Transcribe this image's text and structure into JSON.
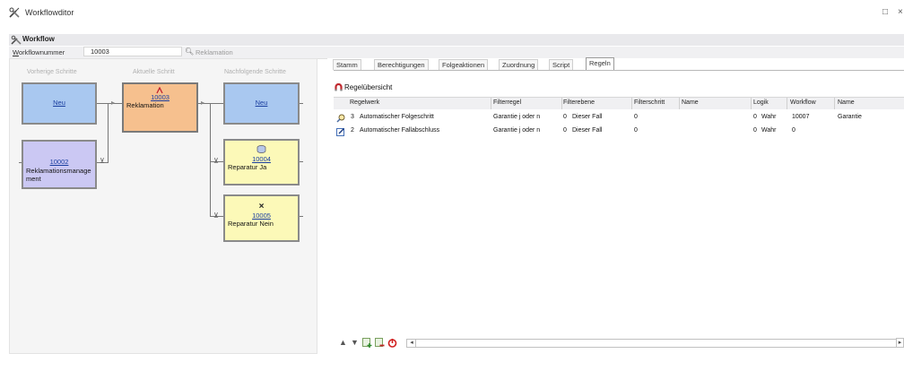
{
  "window": {
    "title": "Workflowditor",
    "maximize_glyph": "□",
    "close_glyph": "×",
    "icon": "tools-icon"
  },
  "workflow_section": {
    "label": "Workflow",
    "icon": "tools-icon"
  },
  "number_row": {
    "label_prefix": "W",
    "label_rest": "orkflownummer",
    "value": "10003",
    "search_icon": "search-icon",
    "name": "Reklamation"
  },
  "columns": {
    "previous": "Vorherige Schritte",
    "current": "Aktuelle Schritt",
    "next": "Nachfolgende Schritte"
  },
  "nodes": {
    "prev_new": {
      "link": "Neu"
    },
    "prev_10002": {
      "link": "10002",
      "name": "Reklamationsmanage ment"
    },
    "current": {
      "link": "10003",
      "name": "Reklamation"
    },
    "next_new": {
      "link": "Neu"
    },
    "next_10004": {
      "link": "10004",
      "name": "Reparatur Ja"
    },
    "next_10005": {
      "link": "10005",
      "name": "Reparatur Nein",
      "mark": "×"
    }
  },
  "tabs": [
    {
      "label": "Stamm",
      "active": false
    },
    {
      "label": "Berechtigungen",
      "active": false
    },
    {
      "label": "Folgeaktionen",
      "active": false
    },
    {
      "label": "Zuordnung",
      "active": false
    },
    {
      "label": "Script",
      "active": false
    },
    {
      "label": "Regeln",
      "active": true
    }
  ],
  "grid": {
    "title": "Regelübersicht",
    "headers": [
      "Regelwerk",
      "Filterregel",
      "Filterebene",
      "Filterschritt",
      "Name",
      "Logik",
      "Workflow",
      "Name"
    ],
    "rows": [
      {
        "icon": "search-icon",
        "num": "3",
        "regelwerk": "Automatischer Folgeschritt",
        "filterregel": "Garantie j oder n",
        "filterebene_n": "0",
        "filterebene": "Dieser Fall",
        "filterschritt": "0",
        "name": "",
        "logik_n": "0",
        "logik": "Wahr",
        "workflow": "10007",
        "name2": "Garantie"
      },
      {
        "icon": "edit-icon",
        "num": "2",
        "regelwerk": "Automatischer Fallabschluss",
        "filterregel": "Garantie j oder n",
        "filterebene_n": "0",
        "filterebene": "Dieser Fall",
        "filterschritt": "0",
        "name": "",
        "logik_n": "0",
        "logik": "Wahr",
        "workflow": "0",
        "name2": ""
      }
    ]
  },
  "toolbar": {
    "move_up": "▲",
    "move_down": "▼",
    "add": "add-row-icon",
    "remove": "remove-row-icon",
    "power": "power-icon",
    "scroll_left": "◂",
    "scroll_right": "▸"
  },
  "colors": {
    "blue_box": "#a9c8f0",
    "orange_box": "#f6c08e",
    "purple_box": "#cbc8f3",
    "yellow_box": "#fcf9b8"
  }
}
